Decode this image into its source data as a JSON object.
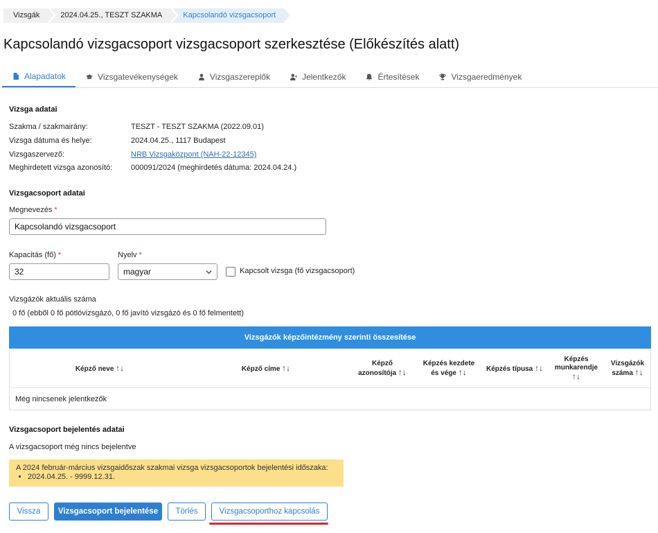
{
  "breadcrumb": [
    "Vizsgák",
    "2024.04.25., TESZT SZAKMA",
    "Kapcsolandó vizsgacsoport"
  ],
  "page_title": "Kapcsolandó vizsgacsoport vizsgacsoport szerkesztése (Előkészítés alatt)",
  "tabs": [
    {
      "label": "Alapadatok",
      "icon": "document-icon"
    },
    {
      "label": "Vizsgatevékenységek",
      "icon": "graduation-cap-icon"
    },
    {
      "label": "Vizsgaszereplők",
      "icon": "user-icon"
    },
    {
      "label": "Jelentkezők",
      "icon": "user-plus-icon"
    },
    {
      "label": "Értesítések",
      "icon": "bell-icon"
    },
    {
      "label": "Vizsgaeredmények",
      "icon": "trophy-icon"
    }
  ],
  "exam_data": {
    "title": "Vizsga adatai",
    "rows": [
      {
        "label": "Szakma / szakmairány:",
        "value": "TESZT - TESZT SZAKMA (2022.09.01)"
      },
      {
        "label": "Vizsga dátuma és helye:",
        "value": "2024.04.25., 1117 Budapest"
      },
      {
        "label": "Vizsgaszervező:",
        "value": "NRB Vizsgaközpont (NAH-22-12345)"
      },
      {
        "label": "Meghirdetett vizsga azonosító:",
        "value": "000091/2024 (meghirdetés dátuma: 2024.04.24.)"
      }
    ]
  },
  "group_data": {
    "title": "Vizsgacsoport adatai",
    "name_label": "Megnevezés",
    "name_value": "Kapcsolandó vizsgacsoport",
    "capacity_label": "Kapacitás (fő)",
    "capacity_value": "32",
    "language_label": "Nyelv",
    "language_value": "magyar",
    "linked_label": "Kapcsolt vizsga (fő vizsgacsoport)",
    "required_mark": "*",
    "current_count_label": "Vizsgázók aktuális száma",
    "current_count_value": "0 fő (ebből 0 fő pótlóvizsgázó, 0 fő javító vizsgázó és 0 fő felmentett)"
  },
  "summary_table": {
    "title": "Vizsgázók képzőintézmény szerinti összesítése",
    "sort_glyph": "↑↓",
    "columns": [
      [
        "Képző neve"
      ],
      [
        "Képző címe"
      ],
      [
        "Képző",
        "azonosítója"
      ],
      [
        "Képzés kezdete",
        "és vége"
      ],
      [
        "Képzés típusa"
      ],
      [
        "Képzés",
        "munkarendje"
      ],
      [
        "Vizsgázók",
        "száma"
      ]
    ],
    "empty_text": "Még nincsenek jelentkezők"
  },
  "registration": {
    "title": "Vizsgacsoport bejelentés adatai",
    "status": "A vizsgacsoport még nincs bejelentve",
    "notice_text": "A 2024 február-március vizsgaidőszak szakmai vizsga vizsgacsoportok bejelentési időszaka:",
    "notice_items": [
      "2024.04.25. - 9999.12.31."
    ]
  },
  "buttons": {
    "back": "Vissza",
    "register": "Vizsgacsoport bejelentése",
    "delete": "Törlés",
    "link": "Vizsgacsoporthoz kapcsolás"
  },
  "colors": {
    "accent": "#2f7fd1",
    "table_header": "#2f8ee0",
    "notice_bg": "#fbdf8a",
    "highlight": "#e0242a"
  }
}
